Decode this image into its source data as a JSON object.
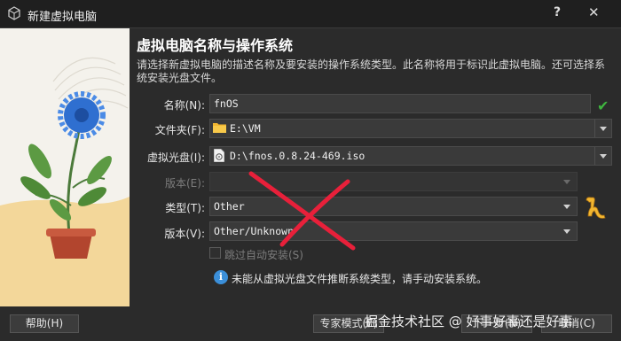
{
  "window": {
    "title": "新建虚拟电脑",
    "help_label": "?",
    "close_label": "✕"
  },
  "page": {
    "heading": "虚拟电脑名称与操作系统",
    "description": "请选择新虚拟电脑的描述名称及要安装的操作系统类型。此名称将用于标识此虚拟电脑。还可选择系统安装光盘文件。"
  },
  "form": {
    "name_label": "名称(N):",
    "name_value": "fnOS",
    "folder_label": "文件夹(F):",
    "folder_value": "E:\\VM",
    "iso_label": "虚拟光盘(I):",
    "iso_value": "D:\\fnos.0.8.24-469.iso",
    "edition_label": "版本(E):",
    "edition_value": "",
    "type_label": "类型(T):",
    "type_value": "Other",
    "version_label": "版本(V):",
    "version_value": "Other/Unknown",
    "skip_label": "跳过自动安装(S)",
    "info_text": "未能从虚拟光盘文件推断系统类型，请手动安装系统。"
  },
  "buttons": {
    "help": "帮助(H)",
    "expert": "专家模式(E)",
    "next": "下一步(N)",
    "cancel": "取消(C)"
  },
  "watermark": "掘金技术社区 @ 好事好事还是好事",
  "icons": {
    "app": "virtualbox-icon",
    "valid": "check-icon",
    "info": "info-icon",
    "os": "unknown-os-icon"
  },
  "colors": {
    "accent": "#3b8fd9",
    "valid": "#3fb53f",
    "annotation": "#e8203a"
  }
}
